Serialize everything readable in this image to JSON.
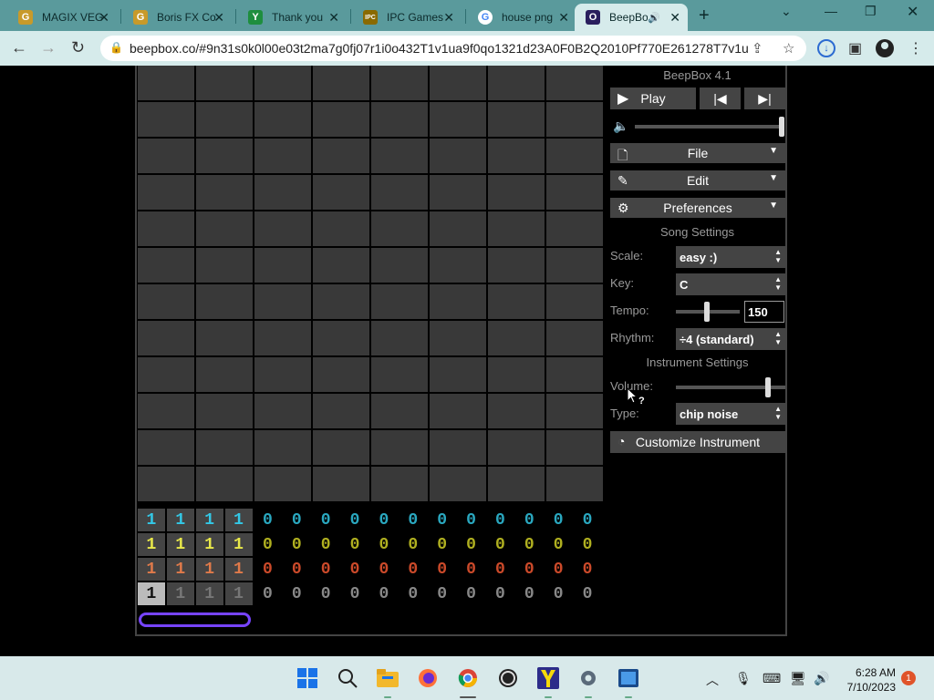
{
  "browser": {
    "tabs": [
      {
        "title": "MAGIX VEG",
        "icon": "magix-favicon",
        "color": "#c89a2a",
        "glyph": "G",
        "active": false
      },
      {
        "title": "Boris FX Co",
        "icon": "borisfx-favicon",
        "color": "#c89a2a",
        "glyph": "G",
        "active": false
      },
      {
        "title": "Thank you",
        "icon": "sheets-favicon",
        "color": "#1e8e3e",
        "glyph": "Y",
        "active": false
      },
      {
        "title": "IPC Games",
        "icon": "ipc-favicon",
        "color": "#8a6a00",
        "glyph": "IPC",
        "active": false
      },
      {
        "title": "house png",
        "icon": "google-favicon",
        "color": "#ffffff",
        "glyph": "G",
        "active": false
      },
      {
        "title": "BeepBo",
        "icon": "beepbox-favicon",
        "color": "#2a1f5e",
        "glyph": "O",
        "active": true
      }
    ],
    "url": "beepbox.co/#9n31s0k0l00e03t2ma7g0fj07r1i0o432T1v1ua9f0qo1321d23A0F0B2Q2010Pf770E261278T7v1u..."
  },
  "app": {
    "title": "BeepBox 4.1",
    "play_label": "Play",
    "menus": [
      {
        "label": "File",
        "icon": "file-icon"
      },
      {
        "label": "Edit",
        "icon": "pencil-icon"
      },
      {
        "label": "Preferences",
        "icon": "gear-icon"
      }
    ],
    "song_settings_header": "Song Settings",
    "scale_label": "Scale:",
    "scale_value": "easy :)",
    "key_label": "Key:",
    "key_value": "C",
    "tempo_label": "Tempo:",
    "tempo_value": "150",
    "rhythm_label": "Rhythm:",
    "rhythm_value": "÷4 (standard)",
    "instrument_settings_header": "Instrument Settings",
    "volume_label": "Volume:",
    "type_label": "Type:",
    "type_value": "chip noise",
    "customize_label": "Customize Instrument",
    "tooltip_mark": "?",
    "track_colors": [
      "#33c8e6",
      "#e8e84a",
      "#e07a4a",
      "#aaaaaa"
    ],
    "track_values": [
      [
        "1",
        "1",
        "1",
        "1",
        "0",
        "0",
        "0",
        "0",
        "0",
        "0",
        "0",
        "0",
        "0",
        "0",
        "0",
        "0"
      ],
      [
        "1",
        "1",
        "1",
        "1",
        "0",
        "0",
        "0",
        "0",
        "0",
        "0",
        "0",
        "0",
        "0",
        "0",
        "0",
        "0"
      ],
      [
        "1",
        "1",
        "1",
        "1",
        "0",
        "0",
        "0",
        "0",
        "0",
        "0",
        "0",
        "0",
        "0",
        "0",
        "0",
        "0"
      ],
      [
        "1",
        "1",
        "1",
        "1",
        "0",
        "0",
        "0",
        "0",
        "0",
        "0",
        "0",
        "0",
        "0",
        "0",
        "0",
        "0"
      ]
    ],
    "zero_colors": [
      "#2aa8c0",
      "#b0b020",
      "#cc4a2a",
      "#888888"
    ]
  },
  "taskbar": {
    "time": "6:28 AM",
    "date": "7/10/2023",
    "notification_count": "1"
  }
}
